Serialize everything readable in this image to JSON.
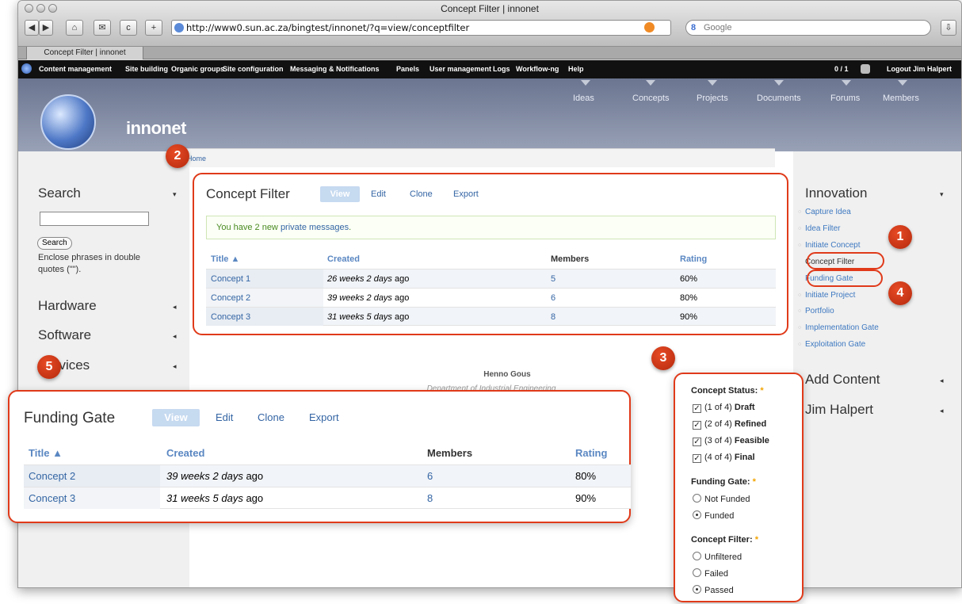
{
  "window": {
    "title": "Concept Filter | innonet",
    "url": "http://www0.sun.ac.za/bingtest/innonet/?q=view/conceptfilter",
    "search_placeholder": "Google",
    "search_engine_label": "8",
    "tab_title": "Concept Filter | innonet",
    "toolbar_buttons": [
      "◀",
      "▶",
      "⌂",
      "✉",
      "c",
      "+"
    ]
  },
  "admin_menu": {
    "items": [
      "Content management",
      "Site building",
      "Organic groups",
      "Site configuration",
      "Messaging & Notifications",
      "Panels",
      "User management",
      "Logs",
      "Workflow-ng",
      "Help"
    ],
    "user_count": "0 / 1",
    "logout": "Logout Jim Halpert"
  },
  "header": {
    "site_name": "innonet",
    "nav": [
      "Ideas",
      "Concepts",
      "Projects",
      "Documents",
      "Forums",
      "Members"
    ]
  },
  "breadcrumb": "Home",
  "left_sidebar": {
    "search_title": "Search",
    "search_button": "Search",
    "search_help": "Enclose phrases in double quotes (\"\").",
    "sections": [
      "Hardware",
      "Software",
      "Services"
    ]
  },
  "concept_filter": {
    "title": "Concept Filter",
    "tabs": [
      "View",
      "Edit",
      "Clone",
      "Export"
    ],
    "message_prefix": "You have 2 new ",
    "message_link": "private messages",
    "message_suffix": ".",
    "columns": [
      "Title",
      "Created",
      "Members",
      "Rating"
    ],
    "rows": [
      {
        "title": "Concept 1",
        "created_italic": "26 weeks 2 days",
        "created_suffix": " ago",
        "members": "5",
        "rating": "60%"
      },
      {
        "title": "Concept 2",
        "created_italic": "39 weeks 2 days",
        "created_suffix": " ago",
        "members": "6",
        "rating": "80%"
      },
      {
        "title": "Concept 3",
        "created_italic": "31 weeks 5 days",
        "created_suffix": " ago",
        "members": "8",
        "rating": "90%"
      }
    ]
  },
  "footer": {
    "name": "Henno Gous",
    "department": "Department of Industrial Engineering"
  },
  "funding_gate": {
    "title": "Funding Gate",
    "tabs": [
      "View",
      "Edit",
      "Clone",
      "Export"
    ],
    "columns": [
      "Title",
      "Created",
      "Members",
      "Rating"
    ],
    "rows": [
      {
        "title": "Concept 2",
        "created_italic": "39 weeks 2 days",
        "created_suffix": " ago",
        "members": "6",
        "rating": "80%"
      },
      {
        "title": "Concept 3",
        "created_italic": "31 weeks 5 days",
        "created_suffix": " ago",
        "members": "8",
        "rating": "90%"
      }
    ]
  },
  "right_sidebar": {
    "innovation_title": "Innovation",
    "links": [
      "Capture Idea",
      "Idea Filter",
      "Initiate Concept",
      "Concept Filter",
      "Funding Gate",
      "Initiate Project",
      "Portfolio",
      "Implementation Gate",
      "Exploitation Gate"
    ],
    "add_content": "Add Content",
    "user_block": "Jim Halpert"
  },
  "filters": {
    "concept_status_label": "Concept Status:",
    "concept_status": [
      {
        "prefix": "(1 of 4) ",
        "name": "Draft"
      },
      {
        "prefix": "(2 of 4) ",
        "name": "Refined"
      },
      {
        "prefix": "(3 of 4) ",
        "name": "Feasible"
      },
      {
        "prefix": "(4 of 4) ",
        "name": "Final"
      }
    ],
    "funding_gate_label": "Funding Gate:",
    "funding_gate": [
      "Not Funded",
      "Funded"
    ],
    "funding_gate_selected": "Funded",
    "concept_filter_label": "Concept Filter:",
    "concept_filter": [
      "Unfiltered",
      "Failed",
      "Passed"
    ],
    "concept_filter_selected": "Passed",
    "required_mark": "*"
  },
  "callouts": [
    "1",
    "2",
    "3",
    "4",
    "5"
  ],
  "colors": {
    "accent": "#e03a1a",
    "link": "#3465a4",
    "header": "#7c86a0"
  }
}
